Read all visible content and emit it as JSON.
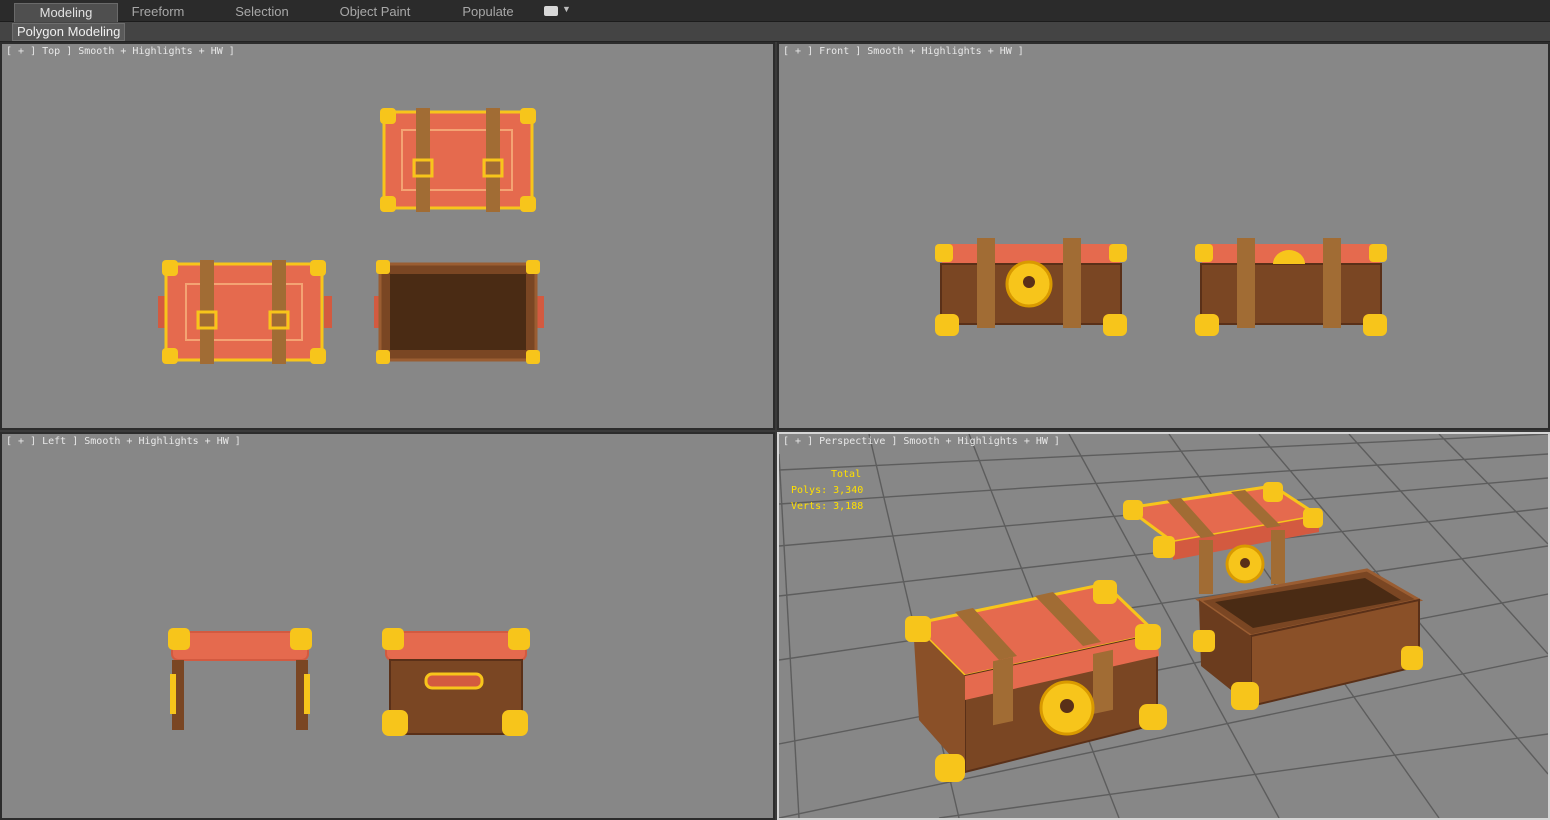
{
  "ribbon": {
    "tabs": [
      {
        "label": "Modeling",
        "active": true
      },
      {
        "label": "Freeform",
        "active": false
      },
      {
        "label": "Selection",
        "active": false
      },
      {
        "label": "Object Paint",
        "active": false
      },
      {
        "label": "Populate",
        "active": false
      }
    ],
    "panel_label": "Polygon Modeling"
  },
  "viewports": {
    "top": {
      "label": "[ + ] Top ] Smooth + Highlights + HW ]"
    },
    "front": {
      "label": "[ + ] Front ] Smooth + Highlights + HW ]"
    },
    "left": {
      "label": "[ + ] Left ] Smooth + Highlights + HW ]"
    },
    "perspective": {
      "label": "[ + ] Perspective ] Smooth + Highlights + HW ]"
    }
  },
  "stats": {
    "heading": "Total",
    "polys": "Polys: 3,340",
    "verts": "Verts: 3,188"
  },
  "colors": {
    "viewport_bg": "#878787",
    "lid_red": "#e56a4e",
    "gold": "#f7c51b",
    "wood": "#7a4623",
    "strap": "#a16c34",
    "stats_yellow": "#ffe000"
  }
}
